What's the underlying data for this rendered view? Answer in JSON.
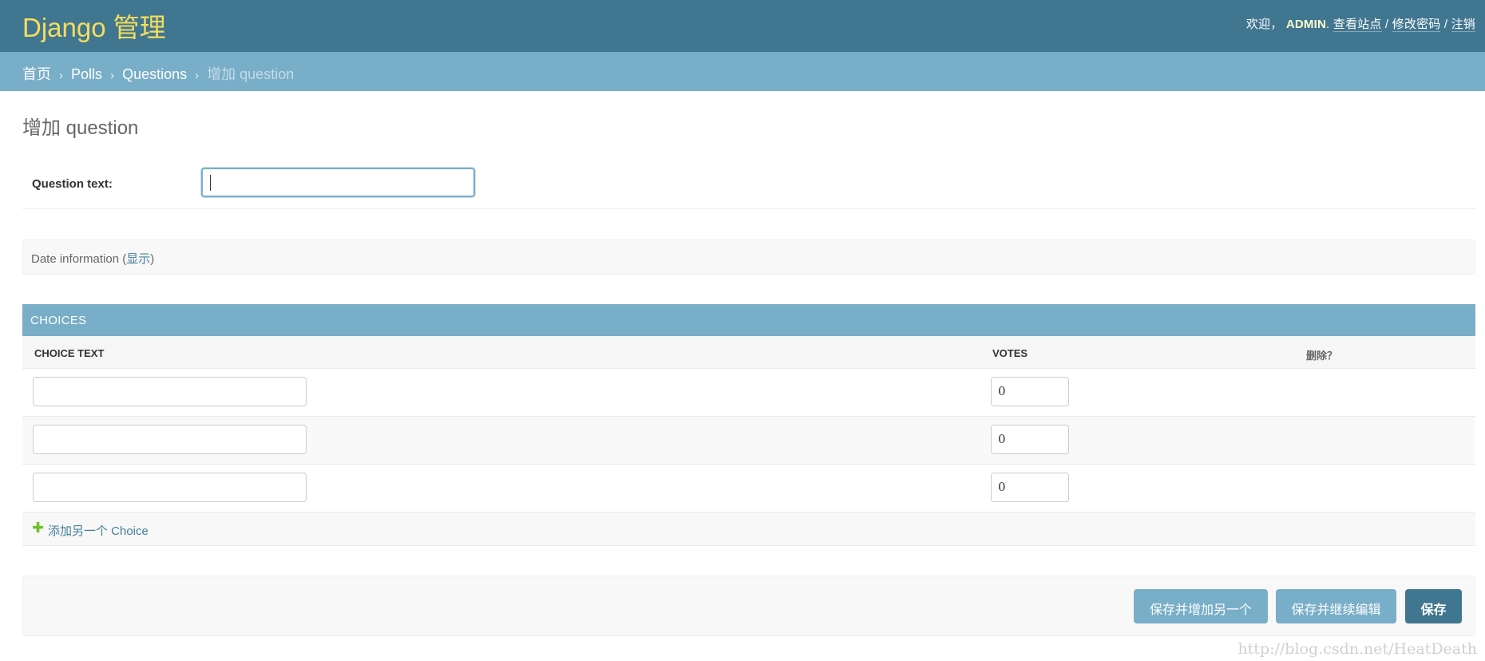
{
  "header": {
    "brand": "Django 管理",
    "welcome": "欢迎，",
    "username": "ADMIN",
    "username_suffix": ".",
    "view_site": "查看站点",
    "change_password": "修改密码",
    "logout": "注销",
    "separator": " / "
  },
  "breadcrumbs": {
    "home": "首页",
    "app": "Polls",
    "model": "Questions",
    "current": "增加 question",
    "sep": "›"
  },
  "page_title": "增加 question",
  "form": {
    "question_label": "Question text:",
    "question_value": ""
  },
  "date_section": {
    "title": "Date information (",
    "toggle": "显示",
    "close_paren": ")"
  },
  "choices": {
    "caption": "CHOICES",
    "headers": {
      "text": "CHOICE TEXT",
      "votes": "VOTES",
      "delete": "删除？"
    },
    "rows": [
      {
        "text": "",
        "votes": "0"
      },
      {
        "text": "",
        "votes": "0"
      },
      {
        "text": "",
        "votes": "0"
      }
    ],
    "add_another": "添加另一个 Choice",
    "add_icon": "plus-icon"
  },
  "submit": {
    "save_add_another": "保存并增加另一个",
    "save_continue": "保存并继续编辑",
    "save": "保存"
  },
  "watermark": "http://blog.csdn.net/HeatDeath",
  "colors": {
    "header_bg": "#417690",
    "breadcrumb_bg": "#79aec8",
    "brand": "#f5dd5d",
    "link": "#447e9b",
    "add_icon": "#70bf2b"
  }
}
